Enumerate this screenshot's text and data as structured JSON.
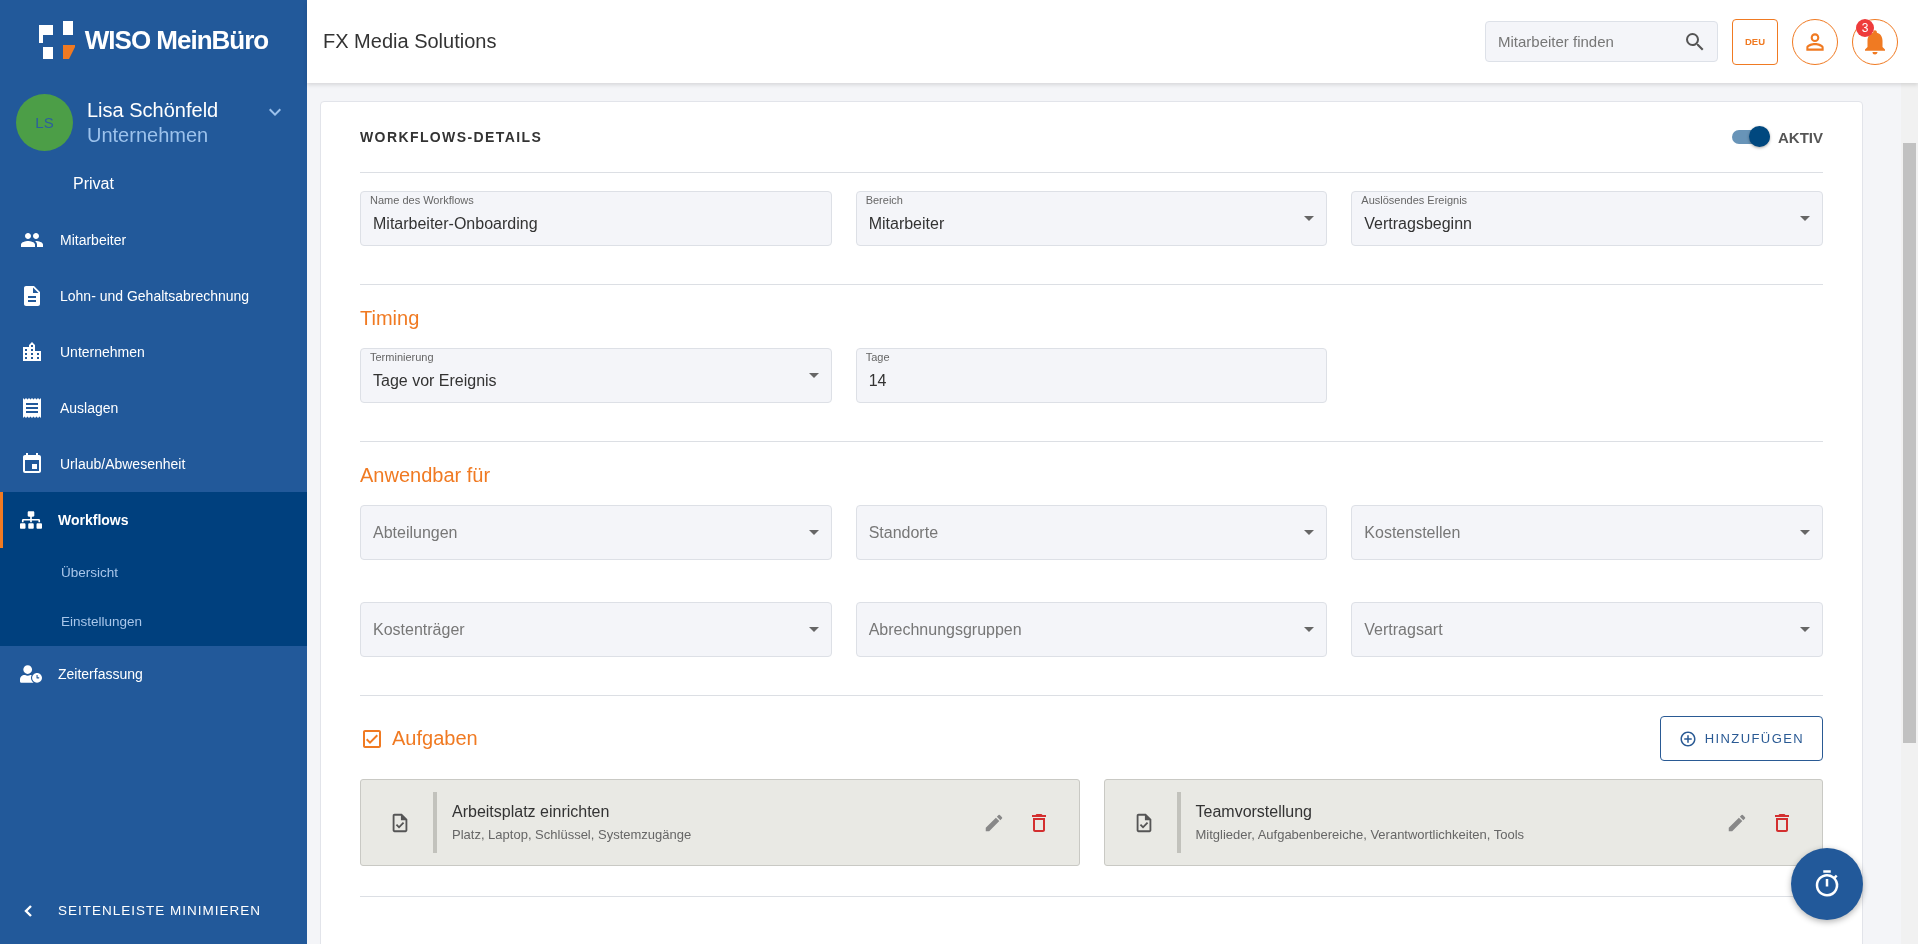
{
  "sidebar": {
    "logo": "WISO MeinBüro",
    "user": {
      "initials": "LS",
      "name": "Lisa Schönfeld",
      "company": "Unternehmen"
    },
    "switch_to": "Privat",
    "nav": [
      {
        "label": "Mitarbeiter",
        "selected": false
      },
      {
        "label": "Lohn- und Gehaltsabrechnung",
        "selected": false
      },
      {
        "label": "Unternehmen",
        "selected": false
      },
      {
        "label": "Auslagen",
        "selected": false
      },
      {
        "label": "Urlaub/Abwesenheit",
        "selected": false
      },
      {
        "label": "Workflows",
        "selected": true,
        "children": [
          {
            "label": "Übersicht",
            "selected": false
          },
          {
            "label": "Einstellungen",
            "selected": false
          }
        ]
      },
      {
        "label": "Zeiterfassung",
        "selected": false
      }
    ],
    "minimize": "SEITENLEISTE MINIMIEREN"
  },
  "header": {
    "title": "FX Media Solutions",
    "search": {
      "placeholder": "Mitarbeiter finden"
    },
    "language": "DEU",
    "notifications": "3"
  },
  "details": {
    "title": "WORKFLOWS-DETAILS",
    "status": {
      "label": "AKTIV",
      "on": true
    },
    "fields": [
      {
        "kind": "text",
        "label": "Name des Workflows",
        "value": "Mitarbeiter-Onboarding"
      },
      {
        "kind": "select",
        "label": "Bereich",
        "value": "Mitarbeiter"
      },
      {
        "kind": "select",
        "label": "Auslösendes Ereignis",
        "value": "Vertragsbeginn"
      }
    ]
  },
  "sections": [
    {
      "kind": "fields",
      "title": "Timing",
      "fields": [
        {
          "kind": "select",
          "label": "Terminierung",
          "value": "Tage vor Ereignis"
        },
        {
          "kind": "text",
          "label": "Tage",
          "value": "14"
        }
      ]
    },
    {
      "kind": "fields",
      "title": "Anwendbar für",
      "fields": [
        {
          "kind": "select",
          "placeholder": "Abteilungen"
        },
        {
          "kind": "select",
          "placeholder": "Standorte"
        },
        {
          "kind": "select",
          "placeholder": "Kostenstellen"
        },
        {
          "kind": "select",
          "placeholder": "Kostenträger"
        },
        {
          "kind": "select",
          "placeholder": "Abrechnungsgruppen"
        },
        {
          "kind": "select",
          "placeholder": "Vertragsart"
        }
      ]
    },
    {
      "kind": "tasks",
      "title": "Aufgaben",
      "action": "HINZUFÜGEN",
      "tasks": [
        {
          "title": "Arbeitsplatz einrichten",
          "description": "Platz, Laptop, Schlüssel, Systemzugänge"
        },
        {
          "title": "Teamvorstellung",
          "description": "Mitglieder, Aufgabenbereiche, Verantwortlichkeiten, Tools"
        }
      ]
    }
  ]
}
